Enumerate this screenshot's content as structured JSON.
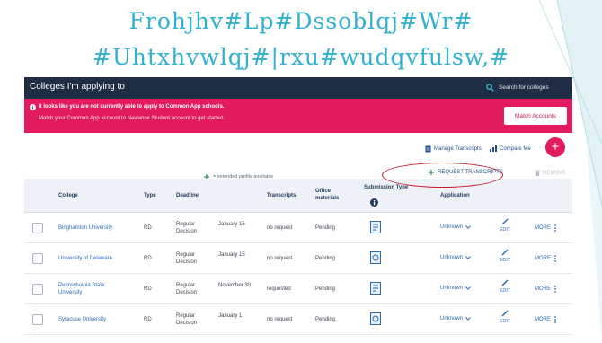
{
  "slide": {
    "title_line1": "Frohjhv#Lp#Dssoblqj#Wr#",
    "title_line2": "#Uhtxhvwlqj#|rxu#wudqvfulsw,#"
  },
  "colors": {
    "title": "#31b1cf",
    "topbar": "#1f2e44",
    "alert": "#e21a5e",
    "link": "#2a6ab3",
    "annotation_oval": "#c01b2b"
  },
  "header": {
    "title": "Colleges I'm applying to",
    "search_label": "Search for colleges"
  },
  "alert": {
    "line1": "It looks like you are not currently able to apply to Common App schools.",
    "line2": "Match your Common App account to Naviance Student account to get started.",
    "button_label": "Match Accounts"
  },
  "actions": {
    "manage_transcripts": "Manage Transcripts",
    "compare_me": "Compare Me",
    "extended_profile_note": "= extended profile available",
    "request_transcripts": "REQUEST TRANSCRIPTS",
    "remove": "REMOVE"
  },
  "table": {
    "columns": {
      "college": "College",
      "type": "Type",
      "deadline": "Deadline",
      "transcripts": "Transcripts",
      "office_materials": "Office materials",
      "submission_type": "Submission Type",
      "application": "Application"
    },
    "rows": [
      {
        "college": "Binghamton University",
        "type": "RD",
        "decision": "Regular Decision",
        "date": "January 15",
        "transcripts": "no request",
        "office": "Pending",
        "application": "Unknown",
        "edit": "EDIT",
        "more": "MORE"
      },
      {
        "college": "University of Delaware",
        "type": "RD",
        "decision": "Regular Decision",
        "date": "January 15",
        "transcripts": "no request",
        "office": "Pending",
        "application": "Unknown",
        "edit": "EDIT",
        "more": "MORE"
      },
      {
        "college": "Pennsylvania State University",
        "type": "RD",
        "decision": "Regular Decision",
        "date": "November 30",
        "transcripts": "requested",
        "office": "Pending",
        "application": "Unknown",
        "edit": "EDIT",
        "more": "MORE"
      },
      {
        "college": "Syracuse University",
        "type": "RD",
        "decision": "Regular Decision",
        "date": "January 1",
        "transcripts": "no request",
        "office": "Pending",
        "application": "Unknown",
        "edit": "EDIT",
        "more": "MORE"
      }
    ]
  },
  "icons": {
    "search": "search-icon",
    "info": "info-icon",
    "manage_transcripts": "document-icon",
    "compare_me": "bar-chart-icon",
    "add": "plus-icon",
    "request_transcripts": "plus-icon",
    "remove": "trash-icon",
    "submission_info": "info-icon",
    "submission_type": "document-icon",
    "application_dropdown": "chevron-down-icon",
    "edit": "pencil-icon",
    "more": "more-vertical-icon"
  }
}
